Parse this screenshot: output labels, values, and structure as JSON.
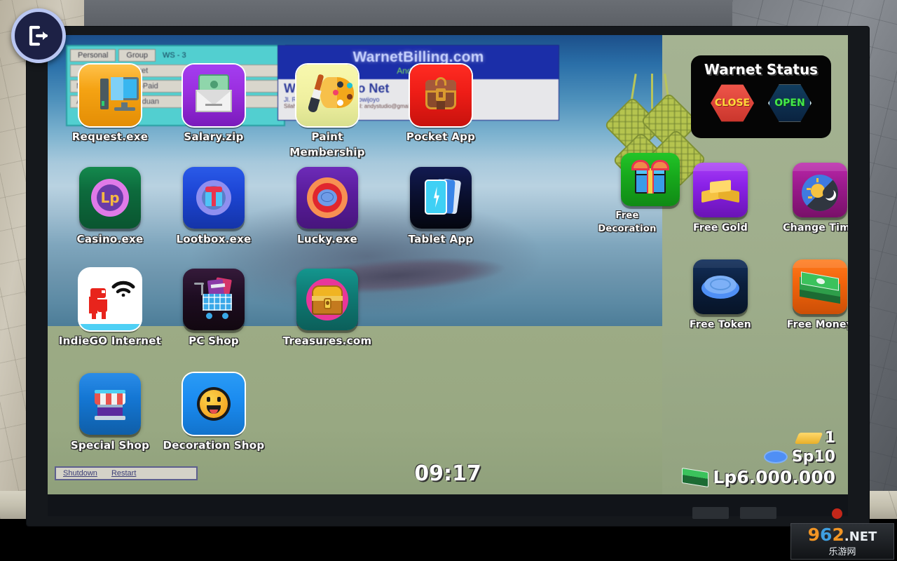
{
  "room": {
    "watermark": {
      "num1": "9",
      "num2": "6",
      "num3": "2",
      "net": ".NET",
      "cn": "乐游网"
    }
  },
  "logout": {
    "name": "logout-button",
    "glyph": "⇥"
  },
  "background_windows": {
    "personal_window": {
      "tabs": [
        "Personal",
        "Group",
        "WS - 3"
      ],
      "rows": [
        {
          "left": "",
          "right": "Paket"
        },
        {
          "left": "M",
          "right": "Pre-Paid"
        },
        {
          "left": "A",
          "right": "Panduan"
        }
      ]
    },
    "billing_window": {
      "title": "WarnetBilling.com",
      "subtitle": "AndyStudio",
      "line1": "Warnet Ngigo Net",
      "line2": "Jl. Raya No-22, Kec. Ongkowijoyo",
      "line3": "Silahkan hubungi kami di email: andystudio@gmail.com"
    }
  },
  "status_panel": {
    "title": "Warnet Status",
    "close_label": "CLOSE",
    "open_label": "OPEN",
    "close_color": "#e24a3c",
    "open_color": "#44e84a"
  },
  "desktop_icons": [
    {
      "label": "Request.exe",
      "icon": "desktop-computer-icon",
      "tile_color": "#f5a313",
      "selected": true
    },
    {
      "label": "Salary.zip",
      "icon": "money-envelope-icon",
      "tile_color": "#9b2fe0",
      "selected": true
    },
    {
      "label": "Paint Membership",
      "icon": "paint-palette-icon",
      "tile_color": "#f2f29a",
      "selected": true
    },
    {
      "label": "Pocket App",
      "icon": "satchel-bag-icon",
      "tile_color": "#ee1d17",
      "selected": true
    },
    {
      "label": "Casino.exe",
      "icon": "casino-chip-icon",
      "tile_color": "#0d6b3d",
      "selected": false
    },
    {
      "label": "Lootbox.exe",
      "icon": "lootbox-gift-icon",
      "tile_color": "#1d46d6",
      "selected": false
    },
    {
      "label": "Lucky.exe",
      "icon": "lucky-wheel-icon",
      "tile_color": "#5b1d9e",
      "selected": false
    },
    {
      "label": "Tablet App",
      "icon": "tablet-cards-icon",
      "tile_color": "#0a1030",
      "selected": false
    },
    {
      "label": "IndieGO Internet",
      "icon": "dino-wifi-icon",
      "tile_color": "#ffffff",
      "selected": true
    },
    {
      "label": "PC Shop",
      "icon": "shopping-cart-icon",
      "tile_color": "#1e0d22",
      "selected": false
    },
    {
      "label": "Treasures.com",
      "icon": "treasure-chest-icon",
      "tile_color": "#0f7a74",
      "selected": false
    },
    {
      "label": "Special Shop",
      "icon": "storefront-icon",
      "tile_color": "#1477d4",
      "selected": false
    },
    {
      "label": "Decoration Shop",
      "icon": "smiley-face-icon",
      "tile_color": "#1a8bf0",
      "selected": true
    }
  ],
  "reward_icons": [
    {
      "label": "Free Decoration",
      "icon": "gift-box-icon",
      "tile_color": "#17a81c"
    },
    {
      "label": "Free Gold",
      "icon": "gold-bars-icon",
      "tile_color": "#8b22e8"
    },
    {
      "label": "Change Time",
      "icon": "day-night-icon",
      "tile_color": "#9c1b8e"
    },
    {
      "label": "Free Token",
      "icon": "token-chip-icon",
      "tile_color": "#0b1f3d"
    },
    {
      "label": "Free Money",
      "icon": "cash-stack-icon",
      "tile_color": "#f2640c"
    }
  ],
  "hud": {
    "gold": {
      "icon": "gold-bar-icon",
      "value": "1"
    },
    "token": {
      "icon": "token-icon",
      "value": "Sp10"
    },
    "money": {
      "icon": "money-icon",
      "value": "Lp6.000.000"
    }
  },
  "clock": {
    "time": "09:17"
  },
  "taskbar": {
    "shutdown": "Shutdown",
    "restart": "Restart"
  },
  "decor": {
    "ketupat": "ketupat-decoration"
  }
}
